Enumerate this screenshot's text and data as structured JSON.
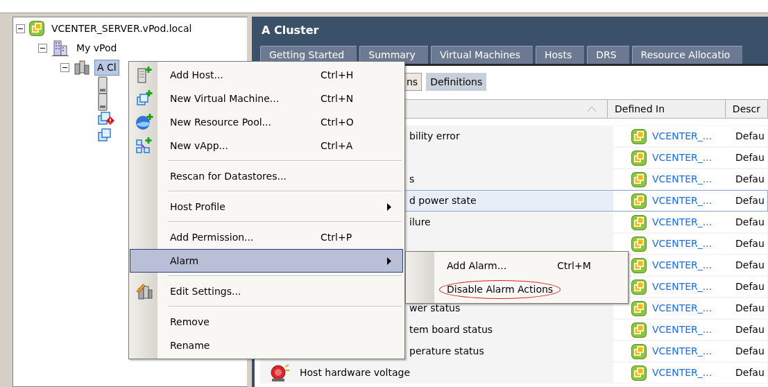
{
  "tree": [
    {
      "label": "VCENTER_SERVER.vPod.local",
      "expanded": true,
      "kind": "vcenter",
      "selected": false,
      "children": [
        {
          "label": "My vPod",
          "expanded": true,
          "kind": "datacenter",
          "selected": false,
          "children": [
            {
              "label": "A Cl",
              "expanded": true,
              "kind": "cluster",
              "selected": true,
              "children": [
                {
                  "kind": "host"
                },
                {
                  "kind": "host"
                },
                {
                  "kind": "vm-alert"
                },
                {
                  "kind": "vm"
                }
              ]
            }
          ]
        }
      ]
    }
  ],
  "panel": {
    "title": "A Cluster",
    "tabs": [
      {
        "label": "Getting Started",
        "selected": false
      },
      {
        "label": "Summary",
        "selected": false
      },
      {
        "label": "Virtual Machines",
        "selected": false
      },
      {
        "label": "Hosts",
        "selected": false
      },
      {
        "label": "DRS",
        "selected": false
      },
      {
        "label": "Resource Allocatio",
        "selected": false
      }
    ],
    "views": [
      {
        "label": "ns",
        "selected": false
      },
      {
        "label": "Definitions",
        "selected": true
      }
    ],
    "table": {
      "columns": [
        "Defined In",
        "Descr"
      ],
      "rows": [
        {
          "kind": "clipped",
          "name": "bility error",
          "selected": false,
          "defined_in": "VCENTER_...",
          "description": "Defau"
        },
        {
          "kind": "clipped",
          "selected": false,
          "defined_in": "VCENTER_...",
          "description": "Defau"
        },
        {
          "kind": "clipped",
          "name": "s",
          "selected": false,
          "defined_in": "VCENTER_...",
          "description": "Defau"
        },
        {
          "kind": "clipped",
          "name": "d power state",
          "selected": true,
          "defined_in": "VCENTER_...",
          "description": "Defau"
        },
        {
          "kind": "clipped",
          "name": "ilure",
          "selected": false,
          "defined_in": "VCENTER_...",
          "description": "Defau"
        },
        {
          "kind": "clipped",
          "selected": false,
          "defined_in": "VCENTER_...",
          "description": "Defau"
        },
        {
          "kind": "clipped",
          "selected": false,
          "defined_in": "VCENTER_...",
          "description": "Defau"
        },
        {
          "kind": "clipped",
          "selected": false,
          "defined_in": "VCENTER_...",
          "description": "Defau"
        },
        {
          "kind": "clipped",
          "name": "wer status",
          "selected": false,
          "defined_in": "VCENTER_...",
          "description": "Defau"
        },
        {
          "kind": "clipped",
          "name": "tem board status",
          "selected": false,
          "defined_in": "VCENTER_...",
          "description": "Defau"
        },
        {
          "kind": "clipped",
          "name": "perature status",
          "selected": false,
          "defined_in": "VCENTER_...",
          "description": "Defau"
        },
        {
          "kind": "alarm",
          "name": "Host hardware voltage",
          "selected": false,
          "defined_in": "VCENTER_...",
          "description": "Defau"
        }
      ]
    }
  },
  "context_menu": {
    "items": [
      {
        "kind": "item",
        "label": "Add Host...",
        "shortcut": "Ctrl+H",
        "has_submenu": false,
        "selected": false
      },
      {
        "kind": "item",
        "label": "New Virtual Machine...",
        "shortcut": "Ctrl+N",
        "has_submenu": false,
        "selected": false
      },
      {
        "kind": "item",
        "label": "New Resource Pool...",
        "shortcut": "Ctrl+O",
        "has_submenu": false,
        "selected": false
      },
      {
        "kind": "item",
        "label": "New vApp...",
        "shortcut": "Ctrl+A",
        "has_submenu": false,
        "selected": false
      },
      {
        "kind": "separator"
      },
      {
        "kind": "item",
        "label": "Rescan for Datastores...",
        "has_submenu": false,
        "selected": false
      },
      {
        "kind": "separator"
      },
      {
        "kind": "item",
        "label": "Host Profile",
        "has_submenu": true,
        "selected": false
      },
      {
        "kind": "separator"
      },
      {
        "kind": "item",
        "label": "Add Permission...",
        "shortcut": "Ctrl+P",
        "has_submenu": false,
        "selected": false
      },
      {
        "kind": "item",
        "label": "Alarm",
        "has_submenu": true,
        "selected": true
      },
      {
        "kind": "separator"
      },
      {
        "kind": "item",
        "label": "Edit Settings...",
        "has_submenu": false,
        "selected": false
      },
      {
        "kind": "separator"
      },
      {
        "kind": "item",
        "label": "Remove",
        "has_submenu": false,
        "selected": false
      },
      {
        "kind": "item",
        "label": "Rename",
        "has_submenu": false,
        "selected": false
      }
    ]
  },
  "submenu": {
    "items": [
      {
        "label": "Add Alarm...",
        "shortcut": "Ctrl+M",
        "circled": false
      },
      {
        "label": "Disable Alarm Actions",
        "circled": true
      }
    ]
  }
}
